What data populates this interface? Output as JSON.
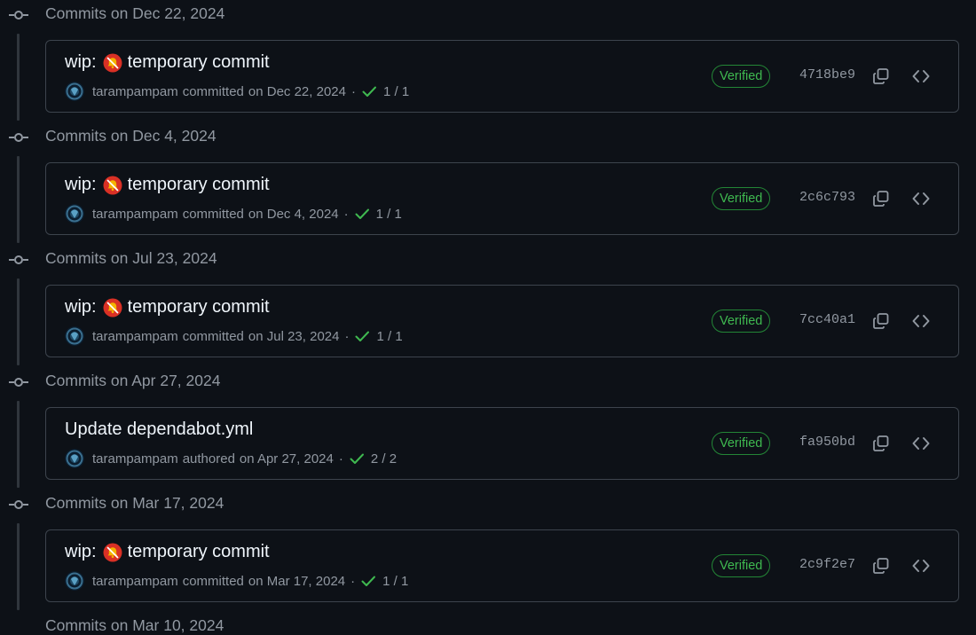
{
  "groups": [
    {
      "title": "Commits on Dec 22, 2024",
      "commit": {
        "prefix": "wip:",
        "emoji": "no-bell",
        "message": "temporary commit",
        "author": "tarampampam",
        "action": "committed",
        "date": "on Dec 22, 2024",
        "separator": "·",
        "checks": "1 / 1",
        "verified": "Verified",
        "sha": "4718be9"
      }
    },
    {
      "title": "Commits on Dec 4, 2024",
      "commit": {
        "prefix": "wip:",
        "emoji": "no-bell",
        "message": "temporary commit",
        "author": "tarampampam",
        "action": "committed",
        "date": "on Dec 4, 2024",
        "separator": "·",
        "checks": "1 / 1",
        "verified": "Verified",
        "sha": "2c6c793"
      }
    },
    {
      "title": "Commits on Jul 23, 2024",
      "commit": {
        "prefix": "wip:",
        "emoji": "no-bell",
        "message": "temporary commit",
        "author": "tarampampam",
        "action": "committed",
        "date": "on Jul 23, 2024",
        "separator": "·",
        "checks": "1 / 1",
        "verified": "Verified",
        "sha": "7cc40a1"
      }
    },
    {
      "title": "Commits on Apr 27, 2024",
      "commit": {
        "prefix": "",
        "emoji": "",
        "message": "Update dependabot.yml",
        "author": "tarampampam",
        "action": "authored",
        "date": "on Apr 27, 2024",
        "separator": "·",
        "checks": "2 / 2",
        "verified": "Verified",
        "sha": "fa950bd"
      }
    },
    {
      "title": "Commits on Mar 17, 2024",
      "commit": {
        "prefix": "wip:",
        "emoji": "no-bell",
        "message": "temporary commit",
        "author": "tarampampam",
        "action": "committed",
        "date": "on Mar 17, 2024",
        "separator": "·",
        "checks": "1 / 1",
        "verified": "Verified",
        "sha": "2c9f2e7"
      }
    }
  ],
  "partial_group_title": "Commits on Mar 10, 2024",
  "colors": {
    "background": "#0d1117",
    "border": "#3d444d",
    "muted_text": "#9198a1",
    "title_text": "#f0f6fc",
    "verified_green": "#3fb950",
    "verified_border": "#238636",
    "timeline_line": "#30363d"
  },
  "icons": {
    "commit_node": "git-commit-icon",
    "check": "check-icon",
    "copy": "copy-icon",
    "browse": "code-icon",
    "emoji": "no-bell-emoji"
  }
}
